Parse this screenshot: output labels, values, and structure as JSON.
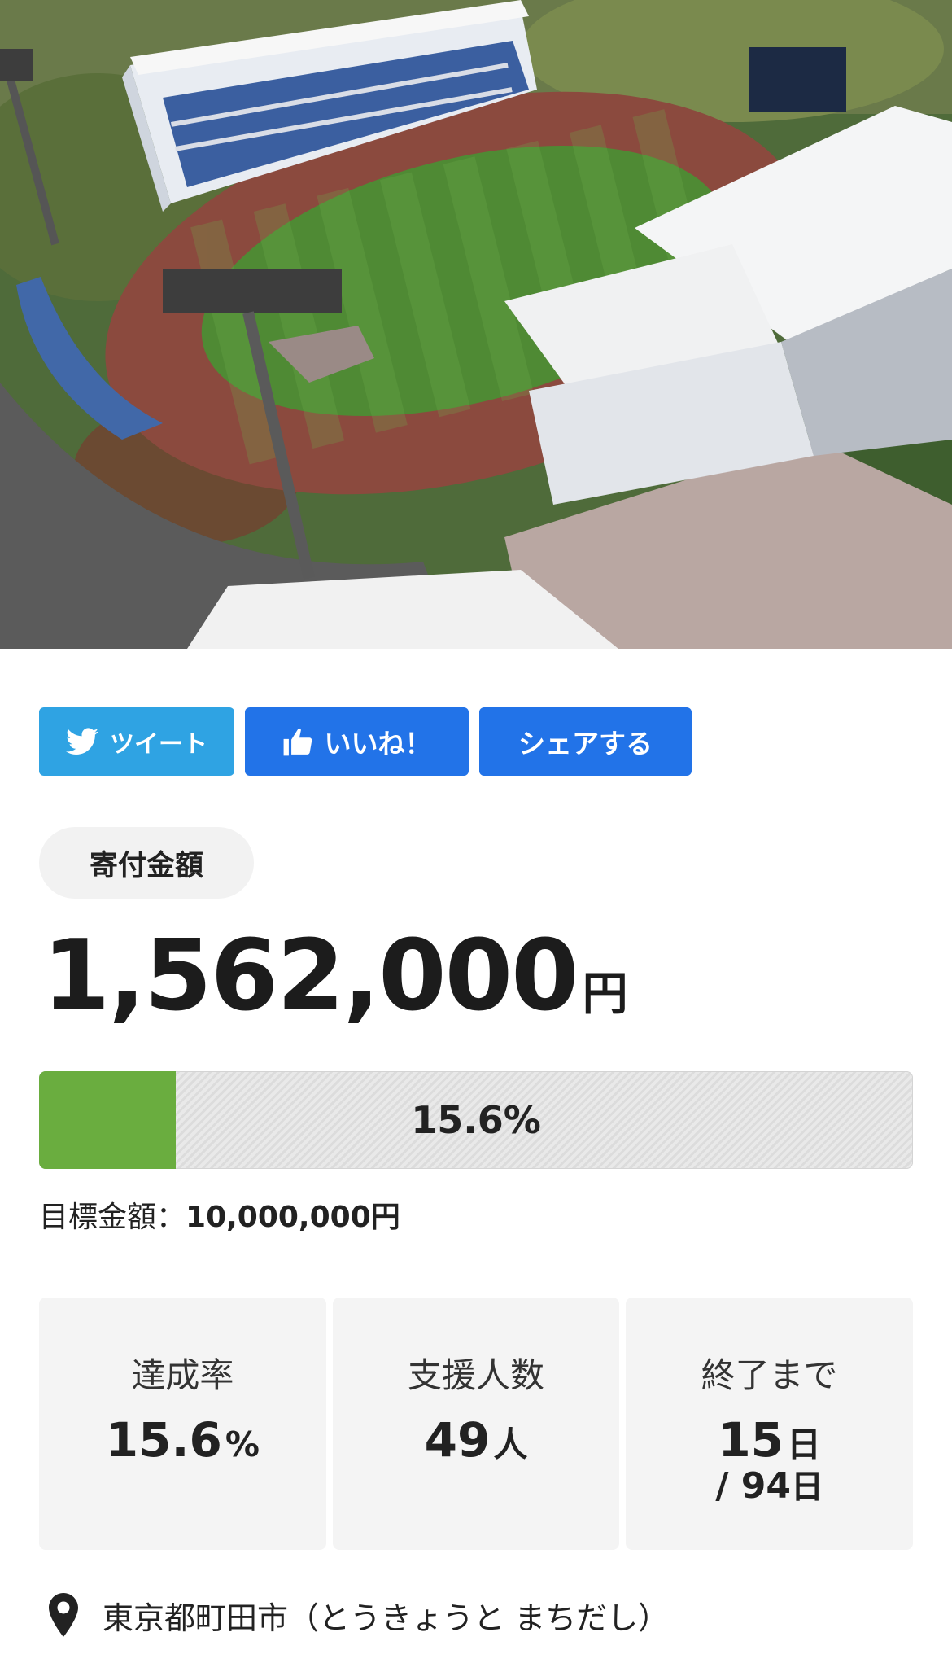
{
  "share": {
    "tweet_label": "ツイート",
    "like_label": "いいね！",
    "share_label": "シェアする"
  },
  "donation": {
    "badge_label": "寄付金額",
    "amount": "1,562,000",
    "currency": "円",
    "progress_percent_text": "15.6%",
    "progress_fraction": 0.156,
    "goal_label": "目標金額：",
    "goal_value": "10,000,000円"
  },
  "stats": {
    "rate_label": "達成率",
    "rate_value": "15.6",
    "rate_unit": "%",
    "supporters_label": "支援人数",
    "supporters_value": "49",
    "supporters_unit": "人",
    "remaining_label": "終了まで",
    "remaining_value": "15",
    "remaining_unit": "日",
    "total_days_text": "/ 94",
    "total_days_unit": "日"
  },
  "location": {
    "text": "東京都町田市（とうきょうと まちだし）"
  },
  "icons": {
    "hero": "stadium-photo",
    "tweet": "twitter-bird-icon",
    "like": "thumbs-up-icon",
    "location": "map-pin-icon"
  },
  "colors": {
    "twitter_blue": "#2fa3e3",
    "facebook_blue": "#2273e8",
    "progress_green": "#6aad3f",
    "badge_bg": "#f2f2f2",
    "stat_bg": "#f4f4f4"
  }
}
